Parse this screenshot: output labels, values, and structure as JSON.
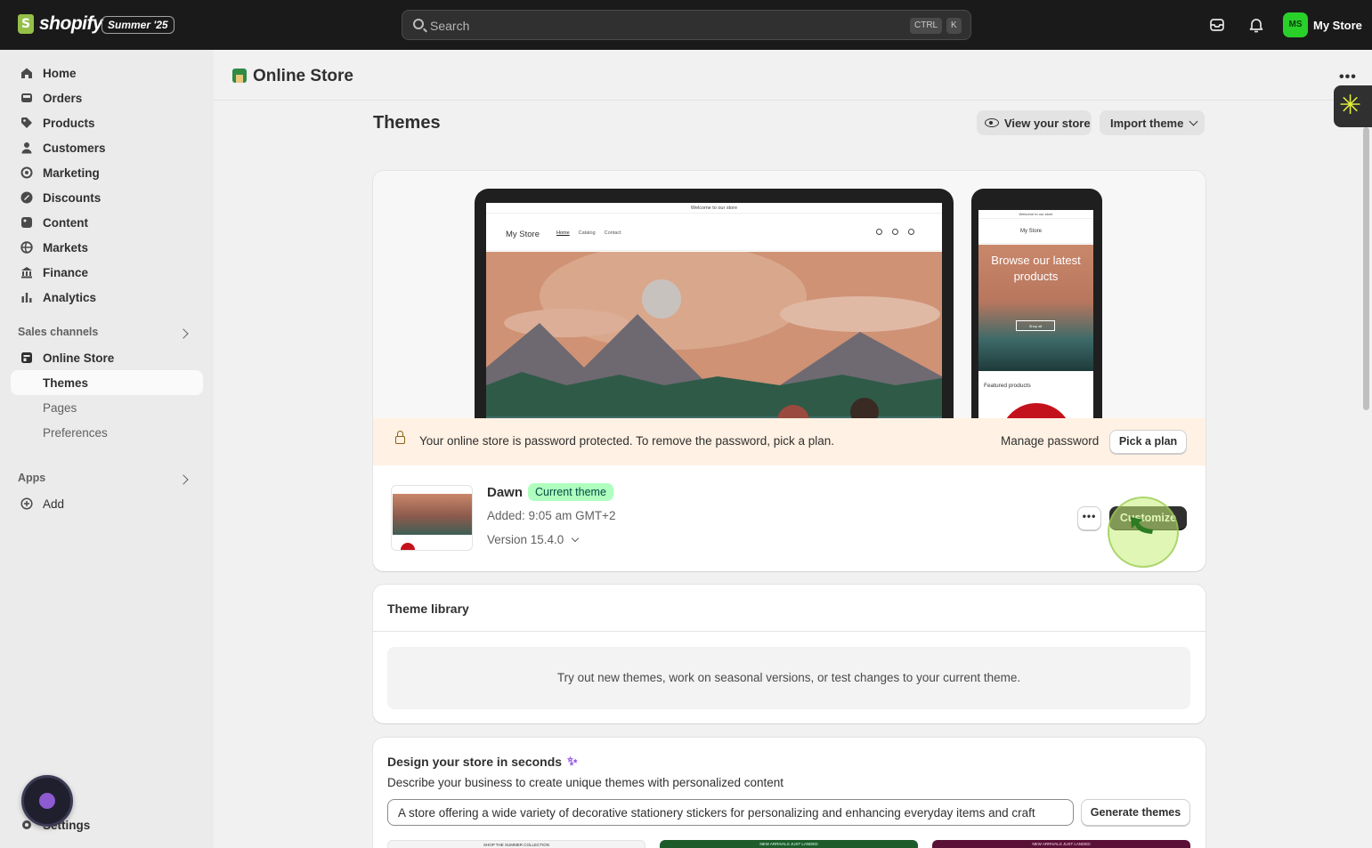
{
  "topbar": {
    "logo_text": "shopify",
    "edition": "Summer '25",
    "search_placeholder": "Search",
    "shortcut_ctrl": "CTRL",
    "shortcut_key": "K",
    "avatar_initials": "MS",
    "store_name": "My Store"
  },
  "sidebar": {
    "items": [
      {
        "label": "Home",
        "icon": "home-icon"
      },
      {
        "label": "Orders",
        "icon": "inbox-icon"
      },
      {
        "label": "Products",
        "icon": "tag-icon"
      },
      {
        "label": "Customers",
        "icon": "person-icon"
      },
      {
        "label": "Marketing",
        "icon": "target-icon"
      },
      {
        "label": "Discounts",
        "icon": "discount-icon"
      },
      {
        "label": "Content",
        "icon": "image-icon"
      },
      {
        "label": "Markets",
        "icon": "globe-icon"
      },
      {
        "label": "Finance",
        "icon": "bank-icon"
      },
      {
        "label": "Analytics",
        "icon": "bar-chart-icon"
      }
    ],
    "sales_channels_label": "Sales channels",
    "online_store": "Online Store",
    "sub_items": [
      "Themes",
      "Pages",
      "Preferences"
    ],
    "apps_label": "Apps",
    "add_label": "Add",
    "settings_label": "Settings"
  },
  "header": {
    "title": "Online Store"
  },
  "themes": {
    "title": "Themes",
    "view_store": "View your store",
    "import_theme": "Import theme"
  },
  "preview": {
    "announcement": "Welcome to our store",
    "brand": "My Store",
    "nav_links": [
      "Home",
      "Catalog",
      "Contact"
    ],
    "mobile_hero": "Browse our latest products",
    "mobile_shop": "Shop all",
    "featured": "Featured products"
  },
  "banner": {
    "message": "Your online store is password protected. To remove the password, pick a plan.",
    "manage_password": "Manage password",
    "pick_plan": "Pick a plan"
  },
  "current_theme": {
    "name": "Dawn",
    "badge": "Current theme",
    "added": "Added: 9:05 am GMT+2",
    "version": "Version 15.4.0",
    "more": "•••",
    "customize": "Customize"
  },
  "library": {
    "title": "Theme library",
    "empty": "Try out new themes, work on seasonal versions, or test changes to your current theme."
  },
  "design": {
    "title": "Design your store in seconds",
    "description": "Describe your business to create unique themes with personalized content",
    "prompt_value": "A store offering a wide variety of decorative stationery stickers for personalizing and enhancing everyday items and craft",
    "generate": "Generate themes",
    "previews": [
      "SHOP THE SUMMER COLLECTION",
      "NEW ARRIVALS JUST LANDED",
      "NEW ARRIVALS JUST LANDED"
    ]
  },
  "colors": {
    "topbar_bg": "#1a1a1a",
    "accent_green": "#2ad02a",
    "badge_bg": "#affebf",
    "banner_bg": "#fff1e3",
    "primary_btn": "#303030"
  }
}
